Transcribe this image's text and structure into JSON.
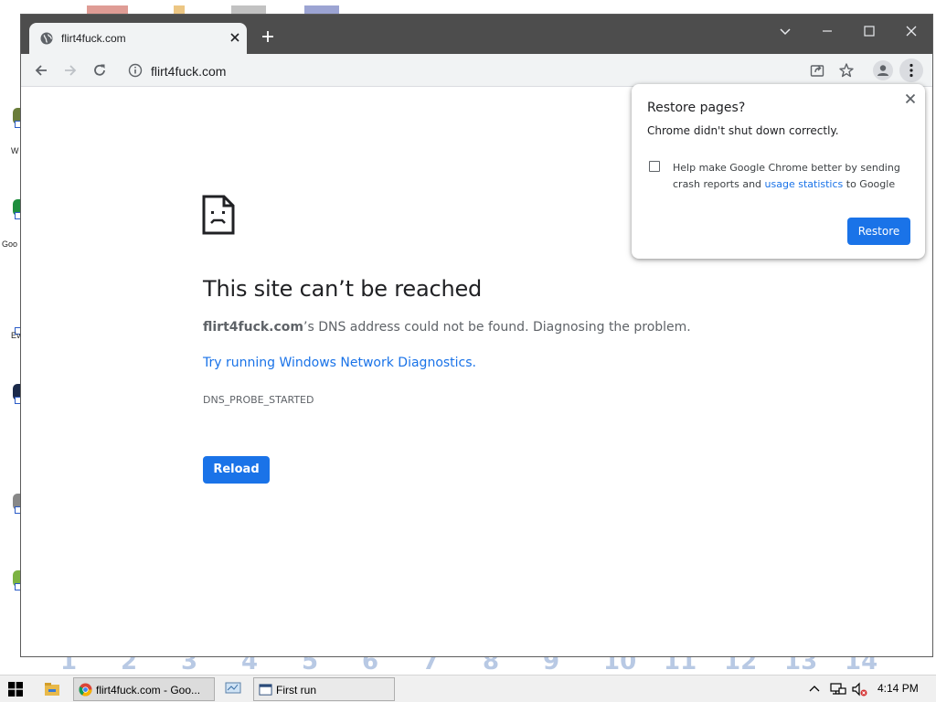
{
  "window": {
    "tab_title": "flirt4fuck.com"
  },
  "omnibox": {
    "url": "flirt4fuck.com"
  },
  "error_page": {
    "title": "This site can’t be reached",
    "host": "flirt4fuck.com",
    "description": "’s DNS address could not be found. Diagnosing the problem.",
    "diagnostics_link": "Try running Windows Network Diagnostics.",
    "error_code": "DNS_PROBE_STARTED",
    "reload_label": "Reload"
  },
  "restore_popup": {
    "title": "Restore pages?",
    "message": "Chrome didn't shut down correctly.",
    "help_text_before": "Help make Google Chrome better by sending crash reports and ",
    "help_link": "usage statistics",
    "help_text_after": " to Google",
    "restore_label": "Restore",
    "checkbox_checked": false
  },
  "desktop": {
    "icon_labels": [
      "W",
      "Goo",
      "Ev"
    ],
    "background_digits": [
      "1",
      "2",
      "3",
      "4",
      "5",
      "6",
      "7",
      "8",
      "9",
      "10",
      "11",
      "12",
      "13",
      "14"
    ]
  },
  "taskbar": {
    "tasks": [
      {
        "label": "flirt4fuck.com - Goo...",
        "icon": "chrome-icon",
        "active": true
      },
      {
        "label": "First run",
        "icon": "app-window-icon",
        "active": false
      }
    ],
    "clock": "4:14 PM"
  },
  "colors": {
    "accent": "#1a73e8",
    "titlebar": "#4d4d4d",
    "toolbar": "#f1f3f4"
  }
}
